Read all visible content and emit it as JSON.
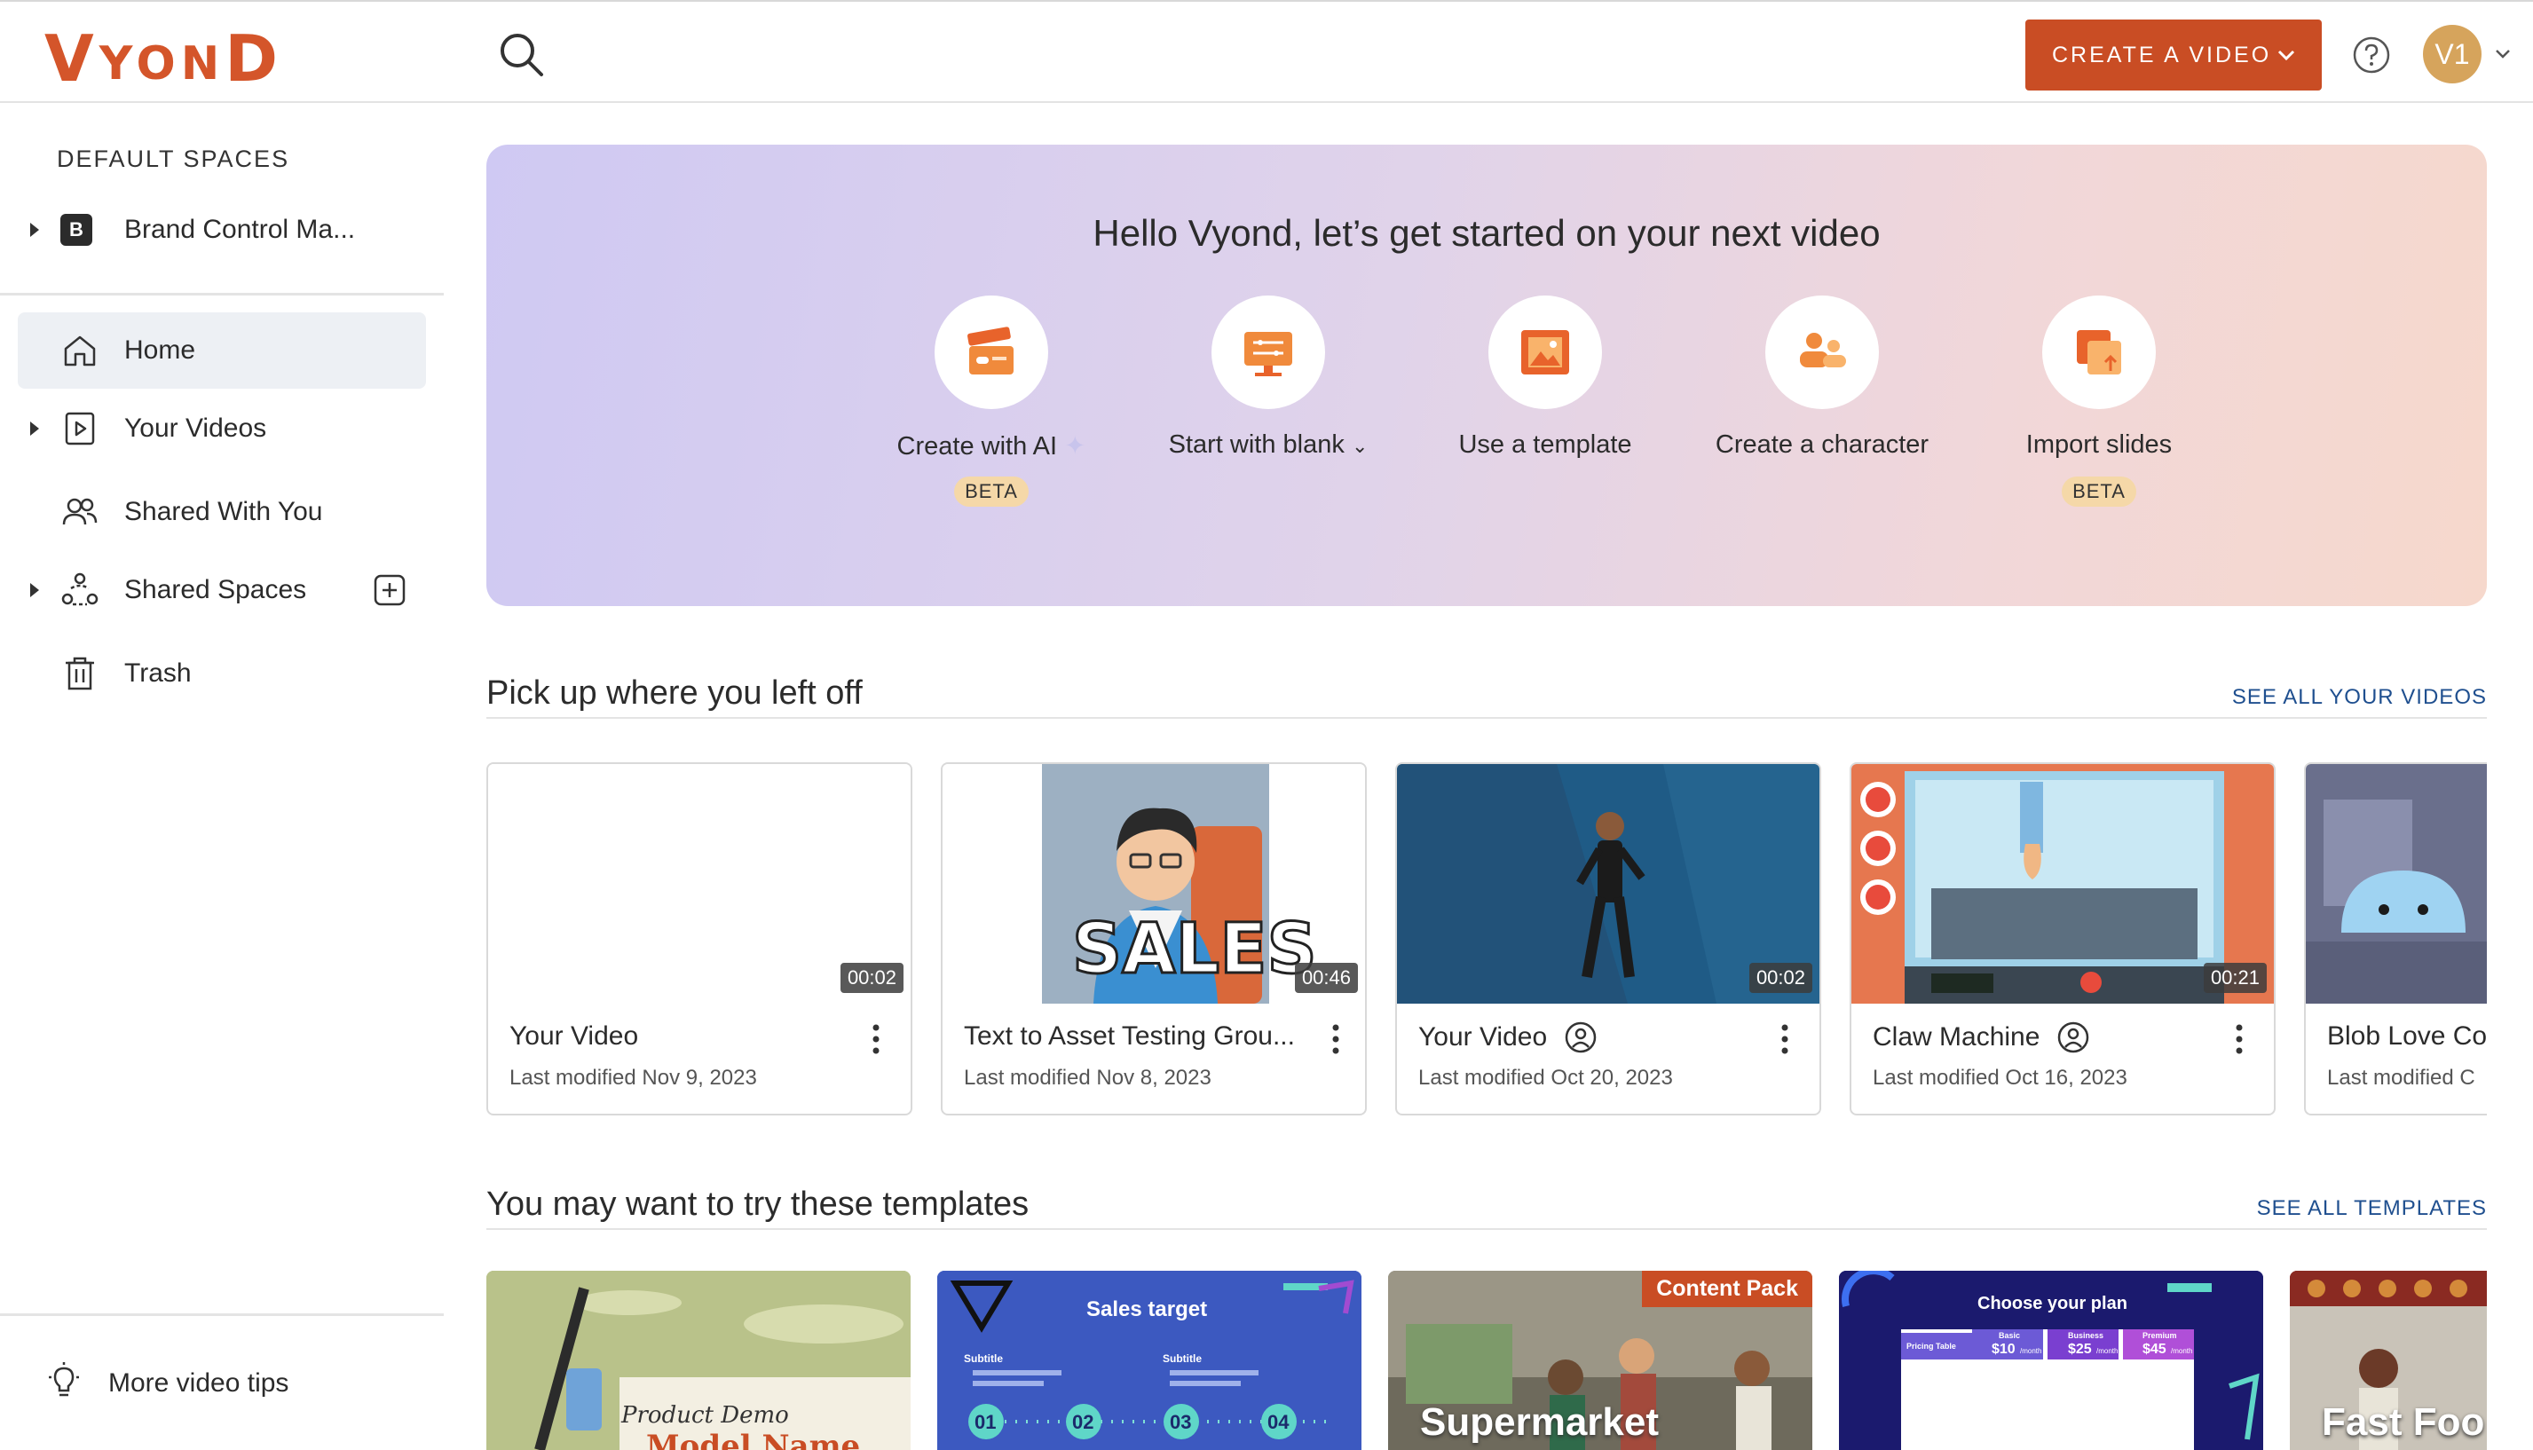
{
  "header": {
    "logo_big_1": "V",
    "logo_small": "YON",
    "logo_big_2": "D",
    "create_label": "CREATE A VIDEO",
    "avatar_initials": "V1",
    "accent": "#c94d24"
  },
  "sidebar": {
    "heading": "DEFAULT SPACES",
    "brand_badge": "B",
    "brand_label": "Brand Control Ma...",
    "items": [
      {
        "label": "Home",
        "icon": "home-icon"
      },
      {
        "label": "Your Videos",
        "icon": "play-square-icon"
      },
      {
        "label": "Shared With You",
        "icon": "users-icon"
      },
      {
        "label": "Shared Spaces",
        "icon": "network-icon"
      },
      {
        "label": "Trash",
        "icon": "trash-icon"
      }
    ],
    "tips_label": "More video tips"
  },
  "banner": {
    "title": "Hello Vyond, let’s get started on your next video",
    "actions": [
      {
        "label": "Create with AI",
        "badge": "BETA"
      },
      {
        "label": "Start with blank"
      },
      {
        "label": "Use a template"
      },
      {
        "label": "Create a character"
      },
      {
        "label": "Import slides",
        "badge": "BETA"
      }
    ]
  },
  "recent": {
    "title": "Pick up where you left off",
    "see_all": "SEE ALL YOUR VIDEOS",
    "videos": [
      {
        "title": "Your Video",
        "date": "Last modified Nov 9, 2023",
        "duration": "00:02"
      },
      {
        "title": "Text to Asset Testing Grou...",
        "date": "Last modified Nov 8, 2023",
        "duration": "00:46",
        "thumb_text": "SALES"
      },
      {
        "title": "Your Video",
        "date": "Last modified Oct 20, 2023",
        "duration": "00:02"
      },
      {
        "title": "Claw Machine",
        "date": "Last modified Oct 16, 2023",
        "duration": "00:21"
      },
      {
        "title": "Blob Love Co",
        "date": "Last modified C"
      }
    ]
  },
  "templates": {
    "title": "You may want to try these templates",
    "see_all": "SEE ALL TEMPLATES",
    "items": [
      {
        "label": "Product Demo",
        "sub": "Model Name"
      },
      {
        "label": "Sales target",
        "steps": [
          "01",
          "02",
          "03",
          "04"
        ],
        "subtitle": "Subtitle"
      },
      {
        "label": "Supermarket",
        "badge": "Content Pack"
      },
      {
        "label": "Choose your plan",
        "plans": [
          "Basic",
          "Business",
          "Premium"
        ],
        "prices": [
          "$10",
          "$25",
          "$45"
        ],
        "unit": "/month",
        "table_label": "Pricing Table"
      },
      {
        "label": "Fast Foo"
      }
    ]
  }
}
